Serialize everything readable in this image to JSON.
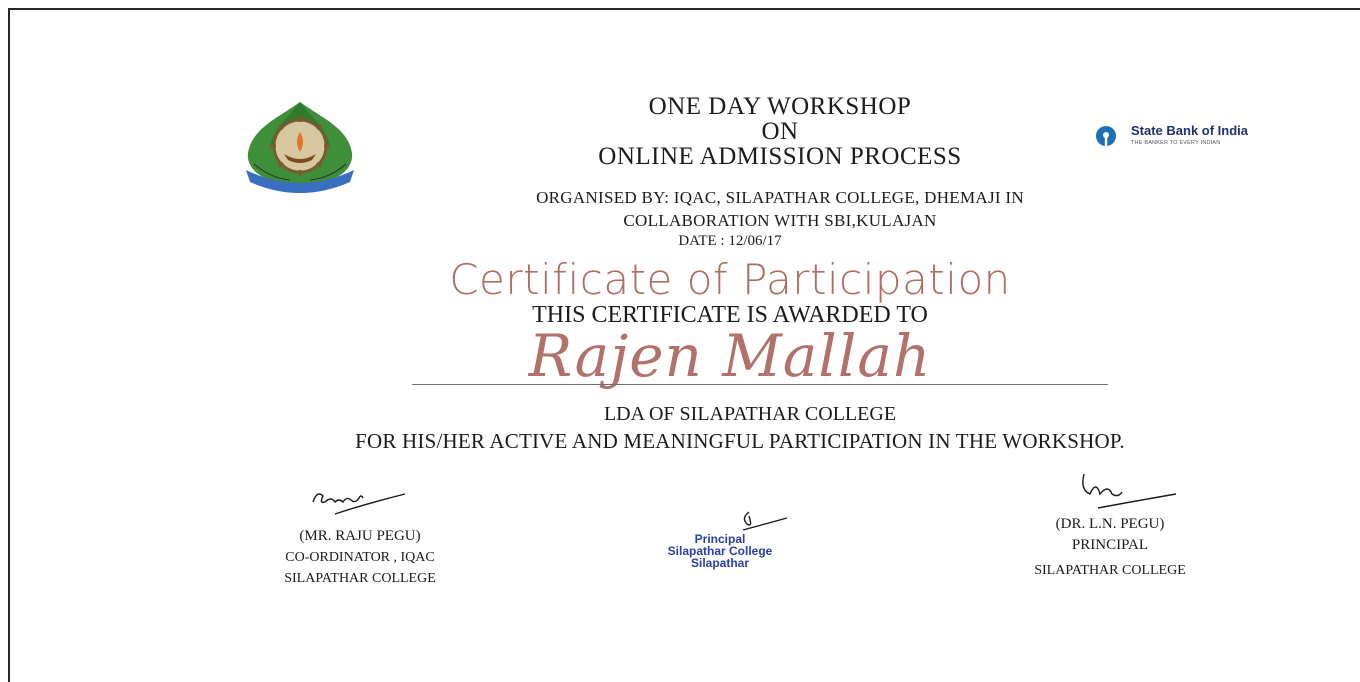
{
  "header": {
    "line1": "ONE DAY WORKSHOP",
    "line2": "ON",
    "line3": "ONLINE ADMISSION PROCESS"
  },
  "organiser": {
    "line1": "ORGANISED BY: IQAC, SILAPATHAR COLLEGE, DHEMAJI IN",
    "line2": "COLLABORATION WITH  SBI,KULAJAN",
    "date": "DATE : 12/06/17"
  },
  "sbi": {
    "name": "State Bank of India",
    "tagline": "THE BANKER TO EVERY INDIAN"
  },
  "certificate": {
    "title": "Certificate of Participation",
    "awarded_to": "THIS CERTIFICATE IS AWARDED TO",
    "recipient": "Rajen Mallah",
    "designation": "LDA OF SILAPATHAR COLLEGE",
    "statement": "FOR HIS/HER ACTIVE AND MEANINGFUL PARTICIPATION IN THE WORKSHOP."
  },
  "signatories": {
    "left": {
      "name": "(MR. RAJU PEGU)",
      "role": "CO-ORDINATOR , IQAC",
      "org": "SILAPATHAR COLLEGE"
    },
    "stamp": {
      "line1": "Principal",
      "line2": "Silapathar College",
      "line3": "Silapathar"
    },
    "right": {
      "name": "(DR. L.N. PEGU)",
      "role": "PRINCIPAL",
      "org": "SILAPATHAR COLLEGE"
    }
  },
  "colors": {
    "accent": "#b06d62",
    "stamp": "#2c3fa3",
    "sbi": "#1e6fb8"
  }
}
